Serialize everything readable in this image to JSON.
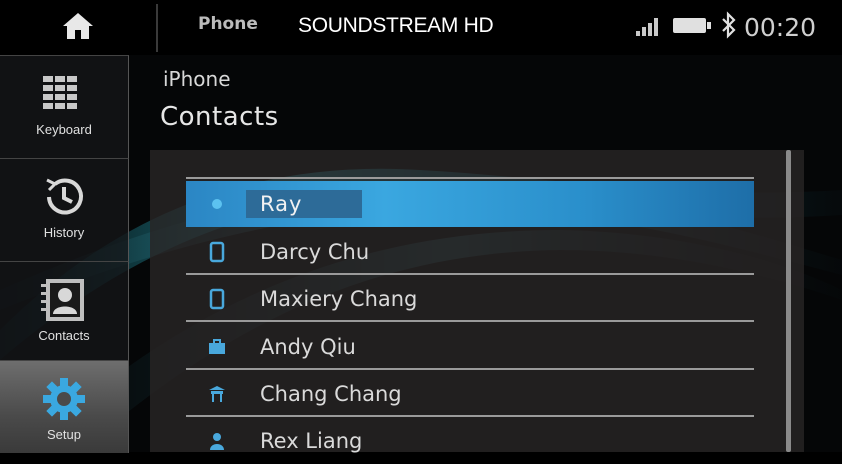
{
  "topbar": {
    "source_label": "Phone",
    "brand": "SOUNDSTREAM HD",
    "clock": "00:20",
    "icons": [
      "home-icon",
      "signal-icon",
      "battery-icon",
      "bluetooth-icon"
    ]
  },
  "sidebar": {
    "items": [
      {
        "label": "Keyboard",
        "icon": "keypad-icon",
        "active": false
      },
      {
        "label": "History",
        "icon": "history-icon",
        "active": false
      },
      {
        "label": "Contacts",
        "icon": "contacts-icon",
        "active": false
      },
      {
        "label": "Setup",
        "icon": "gear-icon",
        "active": true
      }
    ]
  },
  "main": {
    "device": "iPhone",
    "section_title": "Contacts",
    "contacts": [
      {
        "name": "Ray",
        "icon": "contact-icon",
        "selected": true
      },
      {
        "name": "Darcy Chu",
        "icon": "mobile-phone-icon",
        "selected": false
      },
      {
        "name": "Maxiery Chang",
        "icon": "mobile-phone-icon",
        "selected": false
      },
      {
        "name": "Andy Qiu",
        "icon": "work-phone-icon",
        "selected": false
      },
      {
        "name": "Chang Chang",
        "icon": "home-phone-icon",
        "selected": false
      },
      {
        "name": "Rex Liang",
        "icon": "person-icon",
        "selected": false
      }
    ]
  },
  "colors": {
    "accent": "#2b86c4",
    "icon_blue": "#49a8dc",
    "background": "#050607"
  }
}
